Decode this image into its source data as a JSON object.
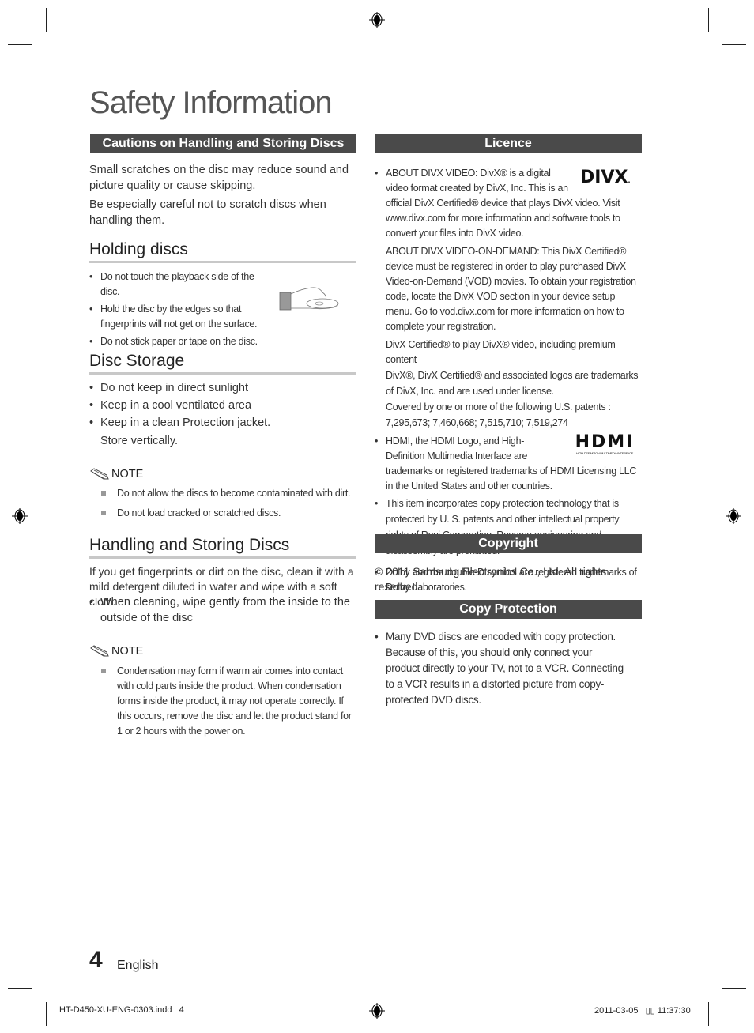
{
  "page_title": "Safety Information",
  "left": {
    "cautions": {
      "header": "Cautions on Handling and Storing Discs",
      "paragraphs": [
        "Small scratches on the disc may reduce sound and picture quality or cause skipping.",
        "Be especially careful not to scratch discs when handling them."
      ]
    },
    "holding": {
      "heading": "Holding discs",
      "items": [
        "Do not touch the playback side of the disc.",
        "Hold the disc by the edges so that fingerprints will not get on the surface.",
        "Do not stick paper or tape on the disc."
      ]
    },
    "storage": {
      "heading": "Disc Storage",
      "items": [
        "Do not keep in direct sunlight",
        "Keep in a cool ventilated area",
        "Keep in a clean Protection jacket."
      ],
      "extra": "Store vertically.",
      "note_label": "NOTE",
      "notes": [
        "Do not allow the discs to become contaminated with dirt.",
        "Do not load cracked or scratched discs."
      ]
    },
    "handling": {
      "heading": "Handling and Storing Discs",
      "intro": "If you get fingerprints or dirt on the disc, clean it with a mild detergent diluted in water and wipe with a soft cloth.",
      "items": [
        "When cleaning, wipe gently from the inside to the outside of the disc"
      ],
      "note_label": "NOTE",
      "notes": [
        "Condensation may form if warm air comes into contact with cold parts inside the product. When condensation forms inside the product, it may not operate correctly. If this occurs, remove the disc and let the product stand for 1 or 2 hours with the power on."
      ]
    }
  },
  "right": {
    "licence": {
      "header": "Licence",
      "divx_logo": "DIVX",
      "divx_p1": "ABOUT DIVX VIDEO: DivX® is a digital video format created by DivX, Inc. This is an official DivX Certified® device that plays DivX video. Visit www.divx.com for more information and software tools to convert your files into DivX video.",
      "divx_p2": "ABOUT DIVX VIDEO-ON-DEMAND: This DivX Certified® device must be registered in order to play purchased DivX Video-on-Demand (VOD) movies. To obtain your registration code, locate the DivX VOD section in your device setup menu. Go to vod.divx.com for more information on how to complete your registration.",
      "divx_p3": "DivX Certified® to play DivX® video, including premium content",
      "divx_p4": "DivX®, DivX Certified® and associated logos are trademarks of DivX, Inc. and are used under license.",
      "divx_p5": "Covered by one or more of the following U.S. patents : 7,295,673; 7,460,668; 7,515,710; 7,519,274",
      "hdmi_logo": "HDMI",
      "hdmi_sub": "HIGH-DEFINITION MULTIMEDIA INTERFACE",
      "hdmi_text": "HDMI, the HDMI Logo, and High-Definition Multimedia Interface are trademarks or registered trademarks of HDMI Licensing LLC in the United States and other countries.",
      "rovi_text": "This item incorporates copy protection technology that is protected by U. S. patents and other intellectual property rights of Rovi Corporation. Reverse engineering and disassembly are prohibited.",
      "dolby_text": "Dolby and the double-D symbol are registered trademarks of Dolby Laboratories."
    },
    "copyright": {
      "header": "Copyright",
      "text": "© 2011 Samsung Electronics Co., Ltd. All rights reserved."
    },
    "copy_protection": {
      "header": "Copy Protection",
      "items": [
        "Many DVD discs are encoded with copy protection. Because of this, you should only connect your product directly to your TV, not to a VCR. Connecting to a VCR results in a distorted picture from copy-protected DVD discs."
      ]
    }
  },
  "footer": {
    "page_number": "4",
    "language": "English",
    "file_name": "HT-D450-XU-ENG-0303.indd   4",
    "timestamp": "2011-03-05   ▯▯ 11:37:30"
  }
}
